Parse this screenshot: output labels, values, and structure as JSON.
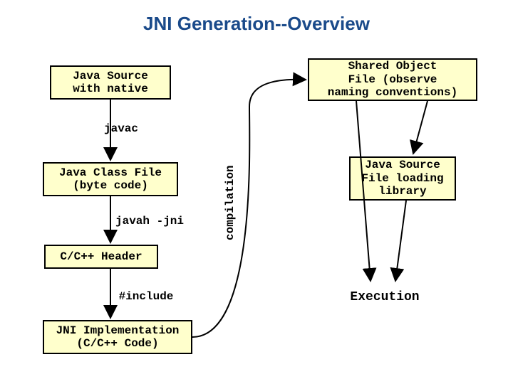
{
  "title": "JNI Generation--Overview",
  "boxes": {
    "java_source_native": "Java Source\nwith native",
    "java_class_file": "Java Class File\n(byte code)",
    "header": "C/C++ Header",
    "jni_impl": "JNI Implementation\n(C/C++ Code)",
    "shared_obj": "Shared Object\nFile (observe\nnaming conventions)",
    "java_source_load": "Java Source\nFile loading\nlibrary"
  },
  "labels": {
    "javac": "javac",
    "javah": "javah -jni",
    "include": "#include",
    "compilation": "compilation",
    "execution": "Execution"
  }
}
